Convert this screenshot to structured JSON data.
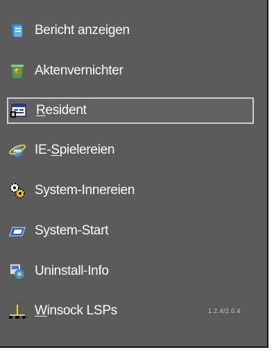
{
  "menu": {
    "items": [
      {
        "label": "Bericht anzeigen",
        "icon": "report-icon",
        "selected": false
      },
      {
        "label": "Aktenvernichter",
        "icon": "shredder-icon",
        "selected": false
      },
      {
        "label_underline": "R",
        "label_rest": "esident",
        "icon": "resident-window-icon",
        "selected": true
      },
      {
        "label_pre": "IE-",
        "label_underline": "S",
        "label_rest": "pielereien",
        "icon": "internet-explorer-icon",
        "selected": false
      },
      {
        "label": "System-Innereien",
        "icon": "gears-icon",
        "selected": false
      },
      {
        "label": "System-Start",
        "icon": "startup-icon",
        "selected": false
      },
      {
        "label": "Uninstall-Info",
        "icon": "uninstall-icon",
        "selected": false
      },
      {
        "label_underline": "W",
        "label_rest": "insock LSPs",
        "icon": "network-icon",
        "selected": false,
        "hint": "1.2.4/2.0.4"
      }
    ]
  },
  "colors": {
    "panel_background": "#5b5b5b",
    "text": "#ffffff",
    "selection_border": "#cfcfcf"
  }
}
